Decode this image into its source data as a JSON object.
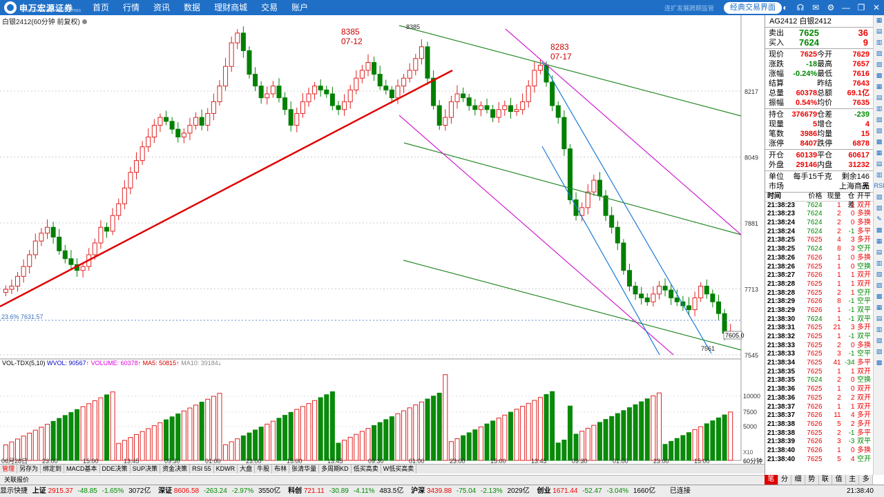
{
  "topbar": {
    "brand": "申万宏源证券",
    "brand_sub": "SHENWAN HONGYUAN SECURITIES",
    "menu": [
      "首页",
      "行情",
      "资讯",
      "数据",
      "理财商城",
      "交易",
      "账户"
    ],
    "faded_text": "连扩发展跨期监管",
    "classic_button": "经典交易界面"
  },
  "chart": {
    "title": "白银2412(60分钟 前复权)",
    "price_labels": [
      "8217",
      "8049",
      "7881",
      "7713",
      "7545"
    ],
    "vol_labels": [
      "10000",
      "7500",
      "5000"
    ],
    "vol_unit": "X10",
    "period_label": "60分钟",
    "high_label_1": {
      "value": "8385",
      "date": "07-12"
    },
    "high_label_2": {
      "value": "8283",
      "date": "07-17"
    },
    "top_marker": "8385",
    "low_marker": "7561",
    "last_marker": "7605.0",
    "fib_label": "23.6% 7631.57",
    "time_labels": [
      "06月28日",
      "23:00",
      "15:00",
      "13:45",
      "09:30",
      "01:00",
      "23:00",
      "15:00",
      "13:45",
      "09:30",
      "01:00",
      "23:00",
      "15:00",
      "13:45",
      "09:30",
      "01:00",
      "23:00",
      "15:00"
    ],
    "vol_legend": {
      "name": "VOL-TDX(5,10)",
      "wvol": "WVOL: 90567",
      "volume": "VOLUME: 60378",
      "ma5": "MA5: 50815",
      "ma10": "MA10: 39184"
    },
    "colors": {
      "up": "#e02020",
      "down": "#008000",
      "trend_red": "#e00000",
      "channel_green": "#2a8a2a",
      "channel_magenta": "#d020d0",
      "channel_blue": "#1a7ad8"
    }
  },
  "bottom_tabs": [
    "管理",
    "另存为",
    "绑定到",
    "MACD基本",
    "DDE决策",
    "SUP决策",
    "资金决策",
    "RSI 55",
    "KDWR",
    "大盘",
    "牛股",
    "布林",
    "张清华量",
    "多周期KD",
    "低买高卖",
    "W低买高卖"
  ],
  "quote_button": "关联报价",
  "panel": {
    "code": "AG2412 白银2412",
    "sell": {
      "label": "卖出",
      "price": "7625",
      "qty": "36"
    },
    "buy": {
      "label": "买入",
      "price": "7624",
      "qty": "9"
    },
    "stats": [
      [
        "现价",
        "7625",
        "今开",
        "7629"
      ],
      [
        "涨跌",
        "-18",
        "最高",
        "7657"
      ],
      [
        "涨幅",
        "-0.24%",
        "最低",
        "7616"
      ],
      [
        "结算",
        "",
        "昨结",
        "7643"
      ],
      [
        "总量",
        "60378",
        "总额",
        "69.1亿"
      ],
      [
        "振幅",
        "0.54%",
        "均价",
        "7635"
      ]
    ],
    "stats2": [
      [
        "持仓",
        "376679",
        "仓差",
        "-239"
      ],
      [
        "现量",
        "5",
        "增仓",
        "4"
      ],
      [
        "笔数",
        "3986",
        "均量",
        "15"
      ],
      [
        "涨停",
        "8407",
        "跌停",
        "6878"
      ]
    ],
    "stats3": [
      [
        "开仓",
        "60139",
        "平仓",
        "60617"
      ],
      [
        "外盘",
        "29146",
        "内盘",
        "31232"
      ]
    ],
    "unit": {
      "label": "单位",
      "value": "每手15千克",
      "remain": "剩余146天"
    },
    "market": {
      "label": "市场",
      "value": "上海商品"
    },
    "trade_headers": [
      "时间",
      "价格",
      "现量",
      "仓差",
      "开平"
    ],
    "trades": [
      [
        "21:38:23",
        "7624",
        "1",
        "1",
        "双开"
      ],
      [
        "21:38:23",
        "7624",
        "2",
        "0",
        "多换"
      ],
      [
        "21:38:24",
        "7624",
        "2",
        "0",
        "多换"
      ],
      [
        "21:38:24",
        "7624",
        "2",
        "-1",
        "多平"
      ],
      [
        "21:38:25",
        "7625",
        "4",
        "3",
        "多开"
      ],
      [
        "21:38:25",
        "7624",
        "8",
        "3",
        "空开"
      ],
      [
        "21:38:26",
        "7626",
        "1",
        "0",
        "多换"
      ],
      [
        "21:38:26",
        "7625",
        "1",
        "0",
        "空换"
      ],
      [
        "21:38:27",
        "7626",
        "1",
        "1",
        "双开"
      ],
      [
        "21:38:28",
        "7625",
        "1",
        "1",
        "双开"
      ],
      [
        "21:38:28",
        "7625",
        "2",
        "1",
        "空开"
      ],
      [
        "21:38:29",
        "7626",
        "8",
        "-1",
        "空平"
      ],
      [
        "21:38:29",
        "7626",
        "1",
        "-1",
        "双平"
      ],
      [
        "21:38:30",
        "7624",
        "1",
        "-1",
        "双平"
      ],
      [
        "21:38:31",
        "7625",
        "21",
        "3",
        "多开"
      ],
      [
        "21:38:32",
        "7625",
        "1",
        "-1",
        "双平"
      ],
      [
        "21:38:33",
        "7625",
        "2",
        "0",
        "多换"
      ],
      [
        "21:38:33",
        "7625",
        "3",
        "-1",
        "空平"
      ],
      [
        "21:38:34",
        "7625",
        "41",
        "-34",
        "多平"
      ],
      [
        "21:38:35",
        "7625",
        "1",
        "1",
        "双开"
      ],
      [
        "21:38:35",
        "7624",
        "2",
        "0",
        "空换"
      ],
      [
        "21:38:36",
        "7625",
        "1",
        "0",
        "双开"
      ],
      [
        "21:38:36",
        "7625",
        "2",
        "2",
        "双开"
      ],
      [
        "21:38:37",
        "7626",
        "1",
        "1",
        "双开"
      ],
      [
        "21:38:37",
        "7626",
        "11",
        "4",
        "多开"
      ],
      [
        "21:38:38",
        "7626",
        "5",
        "2",
        "多开"
      ],
      [
        "21:38:38",
        "7625",
        "2",
        "-1",
        "多平"
      ],
      [
        "21:38:39",
        "7626",
        "3",
        "-3",
        "双平"
      ],
      [
        "21:38:40",
        "7626",
        "1",
        "0",
        "多换"
      ],
      [
        "21:38:40",
        "7625",
        "5",
        "4",
        "空开"
      ]
    ],
    "tabs": [
      "笔",
      "分",
      "细",
      "势",
      "联",
      "值",
      "主",
      "多"
    ]
  },
  "status": {
    "show_quick": "显示快捷",
    "sh": {
      "name": "上证",
      "val": "2915.37",
      "chg": "-48.85",
      "pct": "-1.65%",
      "amt": "3072亿"
    },
    "sz": {
      "name": "深证",
      "val": "8606.58",
      "chg": "-263.24",
      "pct": "-2.97%",
      "amt": "3550亿"
    },
    "kc": {
      "name": "科创",
      "val": "721.11",
      "chg": "-30.89",
      "pct": "-4.11%",
      "amt": "483.5亿"
    },
    "hs": {
      "name": "沪深",
      "val": "3439.88",
      "chg": "-75.04",
      "pct": "-2.13%",
      "amt": "2029亿"
    },
    "cy": {
      "name": "创业",
      "val": "1671.44",
      "chg": "-52.47",
      "pct": "-3.04%",
      "amt": "1660亿"
    },
    "connected": "已连接",
    "time": "21:38:40"
  }
}
